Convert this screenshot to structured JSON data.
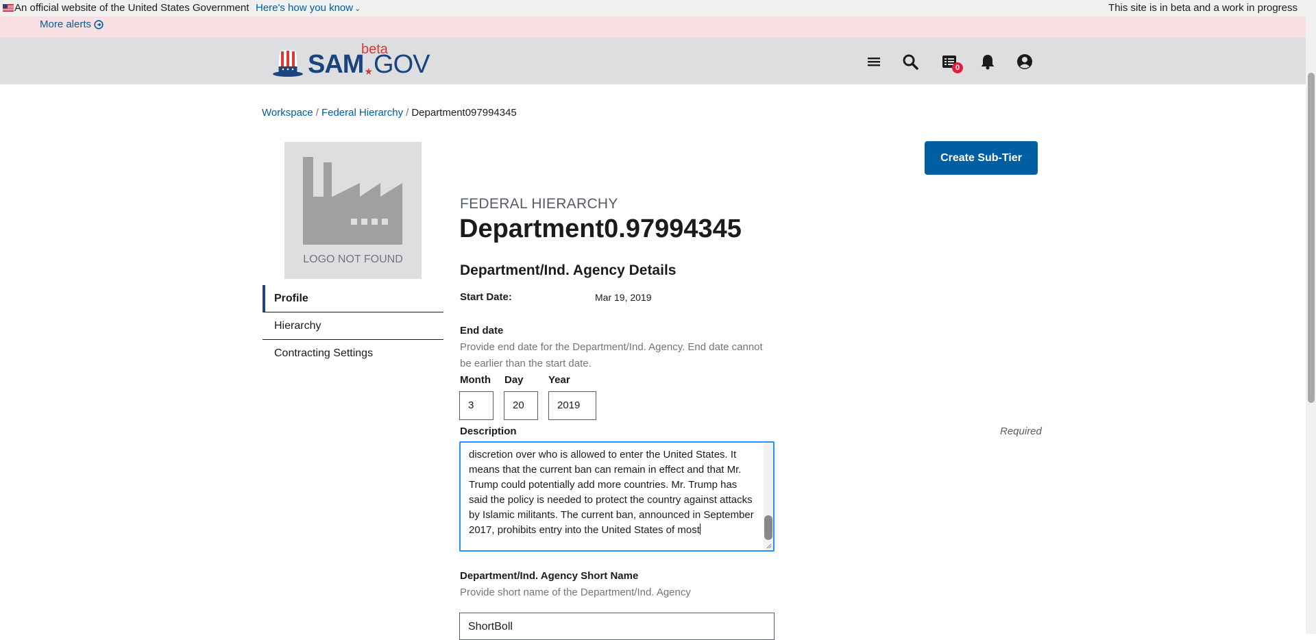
{
  "gov_banner": {
    "official_text": "An official website of the United States Government",
    "how_you_know": "Here's how you know",
    "beta_notice": "This site is in beta and a work in progress"
  },
  "alerts": {
    "more_alerts": "More alerts"
  },
  "header": {
    "logo": {
      "sam": "SAM",
      "gov": "GOV",
      "beta": "beta"
    },
    "notifications_count": "0",
    "icons": [
      "menu-icon",
      "search-icon",
      "messages-icon",
      "bell-icon",
      "user-icon"
    ]
  },
  "breadcrumb": {
    "items": [
      "Workspace",
      "Federal Hierarchy"
    ],
    "current": "Department097994345"
  },
  "profile_logo": {
    "text": "LOGO NOT FOUND"
  },
  "sidenav": {
    "items": [
      "Profile",
      "Hierarchy",
      "Contracting Settings"
    ],
    "active": "Profile"
  },
  "actions": {
    "create_subtier": "Create Sub-Tier"
  },
  "page": {
    "eyebrow": "FEDERAL HIERARCHY",
    "title": "Department0.97994345",
    "section_heading": "Department/Ind. Agency Details"
  },
  "details": {
    "start_date_label": "Start Date:",
    "start_date_value": "Mar 19, 2019",
    "end_date_label": "End date",
    "end_date_hint": "Provide end date for the Department/Ind. Agency. End date cannot be earlier than the start date.",
    "month_label": "Month",
    "day_label": "Day",
    "year_label": "Year",
    "month_value": "3",
    "day_value": "20",
    "year_value": "2019"
  },
  "description": {
    "label": "Description",
    "required": "Required",
    "text": "discretion over who is allowed to enter the United States. It means that the current ban can remain in effect and that Mr. Trump could potentially add more countries. Mr. Trump has said the policy is needed to protect the country against attacks by Islamic militants. The current ban, announced in September 2017, prohibits entry into the United States of most"
  },
  "short_name": {
    "label": "Department/Ind. Agency Short Name",
    "hint": "Provide short name of the Department/Ind. Agency",
    "value": "ShortBoll"
  },
  "colors": {
    "primary": "#005ea2",
    "navy": "#1a4480",
    "alert_bg": "#f8dfe2",
    "header_bg": "#dcdee0",
    "badge_red": "#e31c3d",
    "focus_blue": "#2491ff"
  }
}
